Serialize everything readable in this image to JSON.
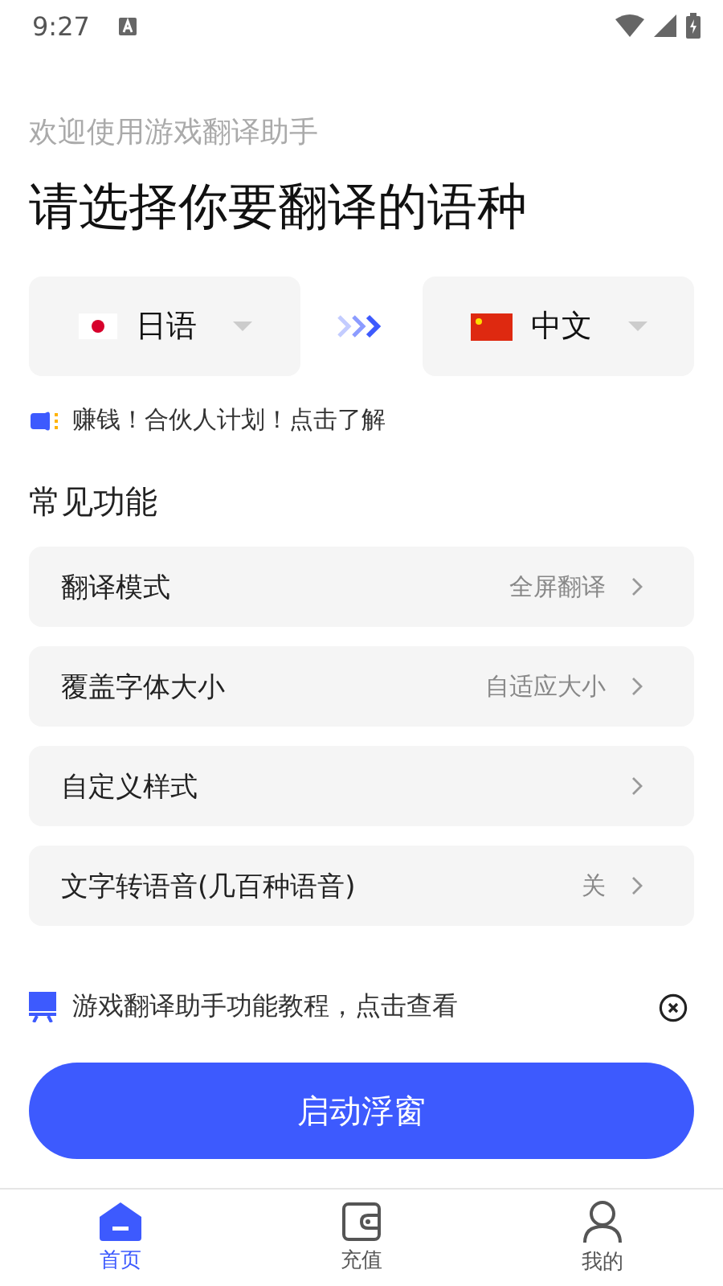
{
  "status_bar": {
    "time": "9:27"
  },
  "header": {
    "subtitle": "欢迎使用游戏翻译助手",
    "title": "请选择你要翻译的语种"
  },
  "languages": [
    {
      "label": "日语"
    },
    {
      "label": "中文"
    }
  ],
  "promo": "赚钱！合伙人计划！点击了解",
  "section_title": "常见功能",
  "settings": [
    {
      "label": "翻译模式",
      "value": "全屏翻译"
    },
    {
      "label": "覆盖字体大小",
      "value": "自适应大小"
    },
    {
      "label": "自定义样式"
    },
    {
      "label": "文字转语音(几百种语音)",
      "value": "关"
    }
  ],
  "tutorial": "游戏翻译助手功能教程，点击查看",
  "start_button": "启动浮窗",
  "tabs": [
    {
      "label": "首页",
      "selected": true
    },
    {
      "label": "充值",
      "selected": false
    },
    {
      "label": "我的",
      "selected": false
    }
  ]
}
